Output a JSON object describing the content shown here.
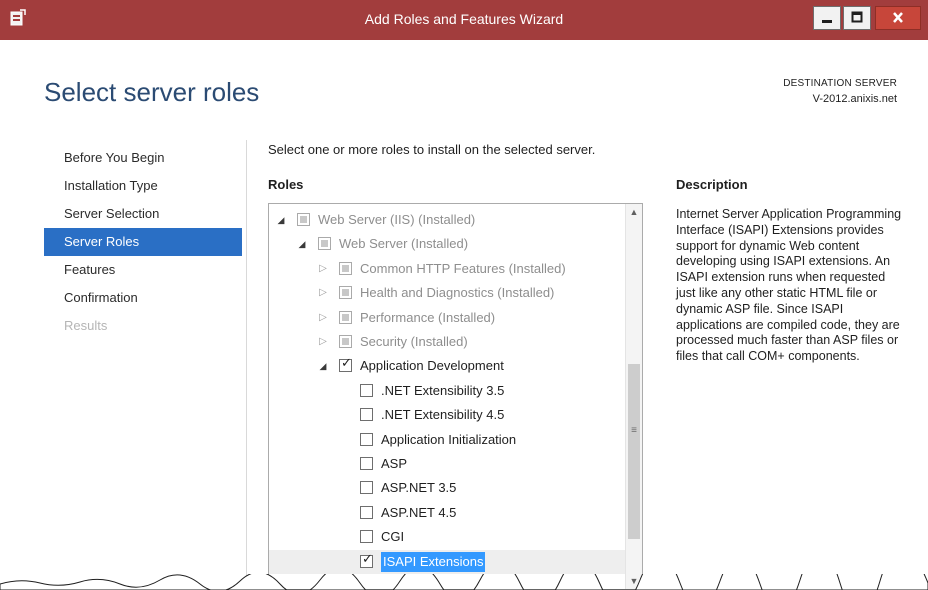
{
  "window": {
    "title": "Add Roles and Features Wizard",
    "icon": "server-manager-icon",
    "controls": {
      "minimize": "minimize-icon",
      "maximize": "maximize-icon",
      "close": "close-icon"
    }
  },
  "header": {
    "title": "Select server roles",
    "destination_label": "DESTINATION SERVER",
    "destination_value": "V-2012.anixis.net"
  },
  "nav": [
    {
      "label": "Before You Begin",
      "state": "normal"
    },
    {
      "label": "Installation Type",
      "state": "normal"
    },
    {
      "label": "Server Selection",
      "state": "normal"
    },
    {
      "label": "Server Roles",
      "state": "active"
    },
    {
      "label": "Features",
      "state": "normal"
    },
    {
      "label": "Confirmation",
      "state": "normal"
    },
    {
      "label": "Results",
      "state": "disabled"
    }
  ],
  "main": {
    "instruction": "Select one or more roles to install on the selected server.",
    "roles_label": "Roles",
    "tree": [
      {
        "label": "Web Server (IIS) (Installed)",
        "level": 0,
        "expander": "open",
        "checkbox": "disabled"
      },
      {
        "label": "Web Server (Installed)",
        "level": 1,
        "expander": "open",
        "checkbox": "disabled"
      },
      {
        "label": "Common HTTP Features (Installed)",
        "level": 2,
        "expander": "closed",
        "checkbox": "disabled"
      },
      {
        "label": "Health and Diagnostics (Installed)",
        "level": 2,
        "expander": "closed",
        "checkbox": "disabled"
      },
      {
        "label": "Performance (Installed)",
        "level": 2,
        "expander": "closed",
        "checkbox": "disabled"
      },
      {
        "label": "Security (Installed)",
        "level": 2,
        "expander": "closed",
        "checkbox": "disabled"
      },
      {
        "label": "Application Development",
        "level": 2,
        "expander": "open",
        "checkbox": "checked"
      },
      {
        "label": ".NET Extensibility 3.5",
        "level": 3,
        "expander": "none",
        "checkbox": "unchecked"
      },
      {
        "label": ".NET Extensibility 4.5",
        "level": 3,
        "expander": "none",
        "checkbox": "unchecked"
      },
      {
        "label": "Application Initialization",
        "level": 3,
        "expander": "none",
        "checkbox": "unchecked"
      },
      {
        "label": "ASP",
        "level": 3,
        "expander": "none",
        "checkbox": "unchecked"
      },
      {
        "label": "ASP.NET 3.5",
        "level": 3,
        "expander": "none",
        "checkbox": "unchecked"
      },
      {
        "label": "ASP.NET 4.5",
        "level": 3,
        "expander": "none",
        "checkbox": "unchecked"
      },
      {
        "label": "CGI",
        "level": 3,
        "expander": "none",
        "checkbox": "unchecked"
      },
      {
        "label": "ISAPI Extensions",
        "level": 3,
        "expander": "none",
        "checkbox": "checked",
        "selected": true
      }
    ],
    "description_label": "Description",
    "description_text": "Internet Server Application Programming Interface (ISAPI) Extensions provides support for dynamic Web content developing using ISAPI extensions. An ISAPI extension runs when requested just like any other static HTML file or dynamic ASP file. Since ISAPI applications are compiled code, they are processed much faster than ASP files or files that call COM+ components."
  },
  "colors": {
    "titlebar": "#a23d3d",
    "accent": "#2a6fc5",
    "title_text": "#2b4b73",
    "selection_highlight": "#3399ff",
    "close_button": "#c7463a"
  }
}
